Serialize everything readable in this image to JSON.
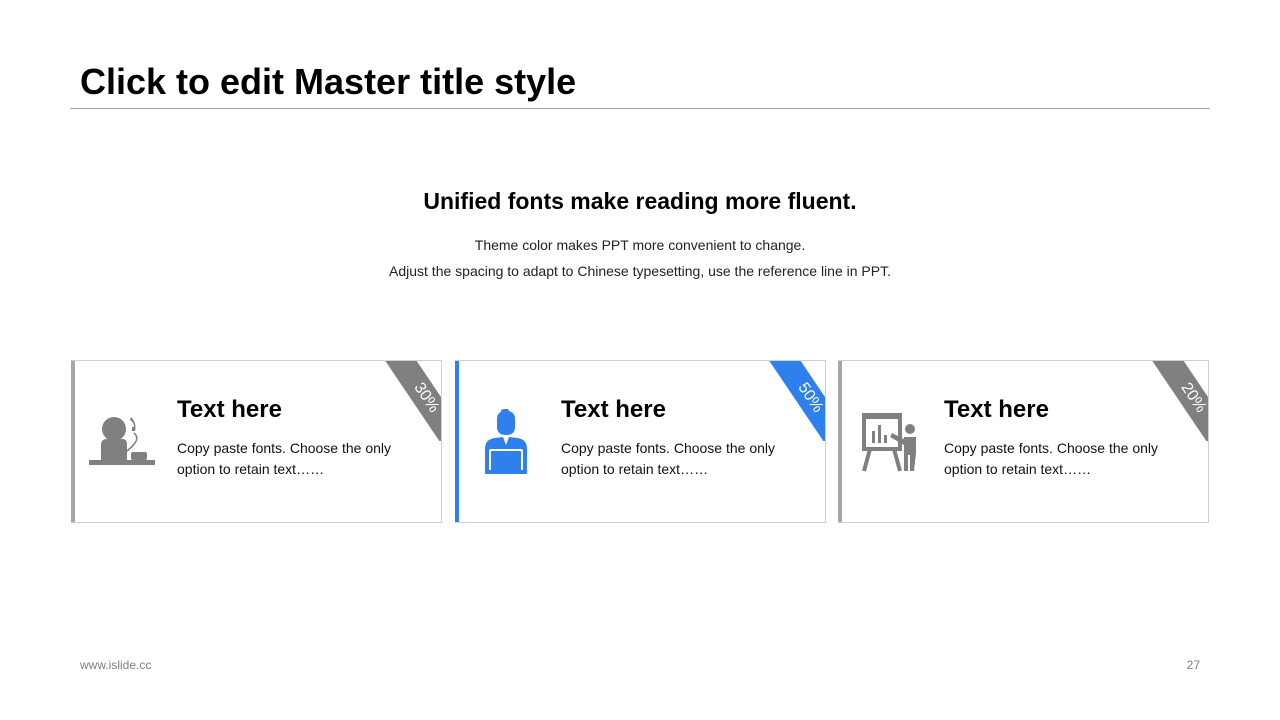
{
  "header": {
    "title": "Click to edit Master title style"
  },
  "intro": {
    "headline": "Unified fonts make reading more fluent.",
    "line1": "Theme color makes PPT more convenient to change.",
    "line2": "Adjust the spacing to adapt to Chinese typesetting, use the reference line in PPT."
  },
  "cards": [
    {
      "title": "Text here",
      "desc": "Copy paste fonts. Choose the only option to retain text……",
      "badge": "30%",
      "accent_color": "#a6a6a6",
      "icon": "phone-call-person-icon"
    },
    {
      "title": "Text here",
      "desc": "Copy paste fonts. Choose the only option to retain text……",
      "badge": "50%",
      "accent_color": "#2f80ed",
      "icon": "laptop-user-icon"
    },
    {
      "title": "Text here",
      "desc": "Copy paste fonts. Choose the only option to retain text……",
      "badge": "20%",
      "accent_color": "#a6a6a6",
      "icon": "presentation-board-icon"
    }
  ],
  "colors": {
    "gray": "#808080",
    "blue": "#2f80ed",
    "rule": "#a6a6a6"
  },
  "footer": {
    "website": "www.islide.cc",
    "page_number": "27"
  }
}
